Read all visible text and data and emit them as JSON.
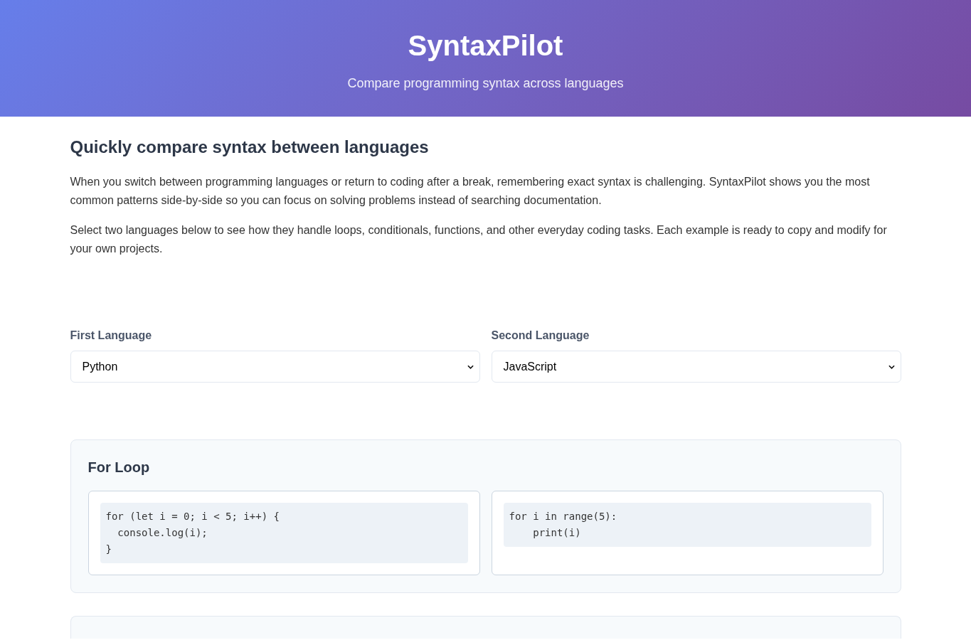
{
  "header": {
    "title": "SyntaxPilot",
    "subtitle": "Compare programming syntax across languages"
  },
  "intro": {
    "heading": "Quickly compare syntax between languages",
    "paragraphs": [
      "When you switch between programming languages or return to coding after a break, remembering exact syntax is challenging. SyntaxPilot shows you the most common patterns side-by-side so you can focus on solving problems instead of searching documentation.",
      "Select two languages below to see how they handle loops, conditionals, functions, and other everyday coding tasks. Each example is ready to copy and modify for your own projects."
    ]
  },
  "language_selectors": [
    {
      "label": "First Language",
      "value": "Python"
    },
    {
      "label": "Second Language",
      "value": "JavaScript"
    }
  ],
  "comparisons": [
    {
      "title": "For Loop",
      "code_blocks": [
        "for (let i = 0; i < 5; i++) {\n  console.log(i);\n}",
        "for i in range(5):\n    print(i)"
      ]
    }
  ]
}
